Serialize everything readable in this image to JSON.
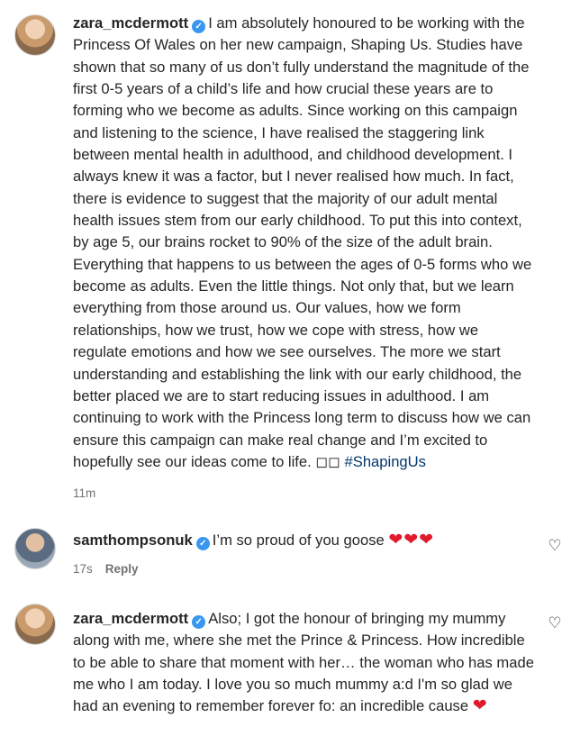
{
  "comments": [
    {
      "username": "zara_mcdermott",
      "verified_glyph": "✓",
      "text": "I am absolutely honoured to be working with the Princess Of Wales on her new campaign, Shaping Us. Studies have shown that so many of us don’t fully understand the magnitude of the first 0-5 years of a child’s life and how crucial these years are to forming who we become as adults. Since working on this campaign and listening to the science, I have realised the staggering link between mental health in adulthood, and childhood development. I always knew it was a factor, but I never realised how much. In fact, there is evidence to suggest that the majority of our adult mental health issues stem from our early childhood. To put this into context, by age 5, our brains rocket to 90% of the size of the adult brain. Everything that happens to us between the ages of 0-5 forms who we become as adults. Even the little things. Not only that, but we learn everything from those around us. Our values, how we form relationships, how we trust, how we cope with stress, how we regulate emotions and how we see ourselves. The more we start understanding and establishing the link with our early childhood, the better placed we are to start reducing issues in adulthood. I am continuing to work with the Princess long term to discuss how we can ensure this campaign can make real change and I’m excited to hopefully see our ideas come to life. ",
      "emoji": "◻◻",
      "hashtag": "#ShapingUs",
      "time": "11m"
    },
    {
      "username": "samthompsonuk",
      "verified_glyph": "✓",
      "text": "I’m so proud of you goose ",
      "hearts": "❤❤❤",
      "time": "17s",
      "reply_label": "Reply",
      "like_icon": "heart-outline-icon",
      "like_glyph": "♡"
    },
    {
      "username": "zara_mcdermott",
      "verified_glyph": "✓",
      "text": "Also; I got the honour of bringing my mummy along with me, where she met the Prince & Princess. How incredible to be able to share that moment with her… the woman who has made me who I am today. I love you so much mummy a:d I'm so glad we had an evening to remember forever fo: an incredible cause ",
      "heart": "❤",
      "like_icon": "heart-outline-icon",
      "like_glyph": "♡"
    }
  ],
  "colors": {
    "verified": "#3897f0",
    "hashtag": "#00376b",
    "meta": "#737373",
    "heart": "#e0192d"
  }
}
